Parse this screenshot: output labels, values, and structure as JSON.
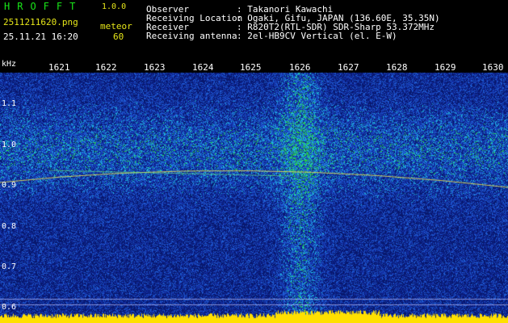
{
  "app": {
    "logo": "HROFFT",
    "version": "1.0.0"
  },
  "capture": {
    "filename": "2511211620.png",
    "datetime": "25.11.21 16:20",
    "type_label": "meteor",
    "count": "60"
  },
  "info": [
    {
      "key": "Observer",
      "value": ": Takanori Kawachi"
    },
    {
      "key": "Receiving Location",
      "value": ": Ogaki, Gifu, JAPAN (136.60E, 35.35N)"
    },
    {
      "key": "Receiver",
      "value": ": R820T2(RTL-SDR) SDR-Sharp 53.372MHz"
    },
    {
      "key": "Receiving antenna",
      "value": ": 2el-HB9CV Vertical (el. E-W)"
    }
  ],
  "axis": {
    "y_unit": "kHz",
    "x_ticks": [
      "1621",
      "1622",
      "1623",
      "1624",
      "1625",
      "1626",
      "1627",
      "1628",
      "1629",
      "1630"
    ],
    "y_ticks": [
      "1.1",
      "1.0",
      "0.9",
      "0.8",
      "0.7",
      "0.6"
    ]
  },
  "colors": {
    "background": "#0a1c78",
    "text_green": "#19e619",
    "text_yellow": "#e6e619",
    "echo": "#ffe000"
  }
}
